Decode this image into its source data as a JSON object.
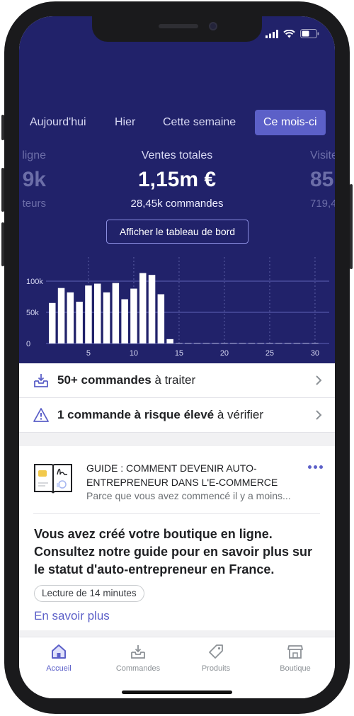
{
  "tabs": [
    {
      "label": "Aujourd'hui",
      "active": false
    },
    {
      "label": "Hier",
      "active": false
    },
    {
      "label": "Cette semaine",
      "active": false
    },
    {
      "label": "Ce mois-ci",
      "active": true
    }
  ],
  "stats": {
    "left": {
      "label": "ligne",
      "value": "9k",
      "sub": "teurs"
    },
    "center": {
      "label": "Ventes totales",
      "value": "1,15m €",
      "sub": "28,45k commandes"
    },
    "right": {
      "label": "Visite",
      "value": "85",
      "sub": "719,4"
    }
  },
  "dashboard_button": "Afficher le tableau de bord",
  "chart_data": {
    "type": "bar",
    "x": [
      1,
      2,
      3,
      4,
      5,
      6,
      7,
      8,
      9,
      10,
      11,
      12,
      13,
      14,
      15,
      16,
      17,
      18,
      19,
      20,
      21,
      22,
      23,
      24,
      25,
      26,
      27,
      28,
      29,
      30
    ],
    "values": [
      65000,
      89000,
      82000,
      67000,
      93000,
      96000,
      82000,
      97000,
      71000,
      88000,
      113000,
      110000,
      79000,
      7000,
      1000,
      1000,
      1000,
      1000,
      1000,
      1000,
      1000,
      1000,
      1000,
      1000,
      1000,
      1000,
      1000,
      1000,
      1000,
      1000
    ],
    "xticks": [
      "5",
      "10",
      "15",
      "20",
      "25",
      "30"
    ],
    "yticks": [
      "0",
      "50k",
      "100k"
    ],
    "ylim": [
      0,
      130000
    ],
    "grid": true
  },
  "rows": [
    {
      "bold": "50+ commandes",
      "rest": " à traiter",
      "icon": "inbox-download-icon"
    },
    {
      "bold": "1 commande à risque élevé",
      "rest": " à vérifier",
      "icon": "warning-triangle-icon"
    }
  ],
  "card": {
    "title": "GUIDE : COMMENT DEVENIR AUTO-ENTREPRENEUR DANS L'E-COMMERCE",
    "subtitle": "Parce que vous avez commencé il y a moins...",
    "body": "Vous avez créé votre boutique en ligne. Consultez notre guide pour en savoir plus sur le statut d'auto-entrepreneur en France.",
    "pill": "Lecture de 14 minutes",
    "link": "En savoir plus"
  },
  "tabbar": [
    {
      "label": "Accueil",
      "icon": "home-icon",
      "active": true
    },
    {
      "label": "Commandes",
      "icon": "orders-icon",
      "active": false
    },
    {
      "label": "Produits",
      "icon": "tag-icon",
      "active": false
    },
    {
      "label": "Boutique",
      "icon": "store-icon",
      "active": false
    }
  ],
  "colors": {
    "hero_bg": "#21226a",
    "accent": "#5c60c8",
    "bar": "#ffffff"
  }
}
